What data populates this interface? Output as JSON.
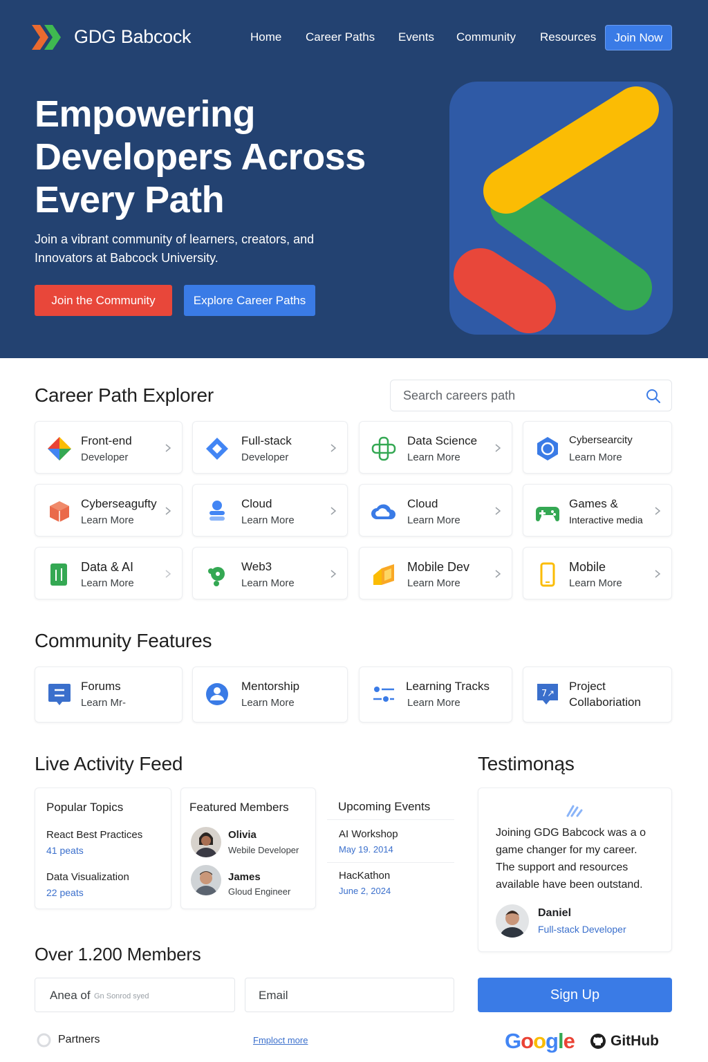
{
  "brand": {
    "name": "GDG Babcock"
  },
  "nav": {
    "items": [
      "Home",
      "Career Paths",
      "Events",
      "Community",
      "Resources"
    ],
    "cta": "Join Now"
  },
  "hero": {
    "title_lines": [
      "Empowering",
      "Developers Across",
      "Every Path"
    ],
    "subtitle_lines": [
      "Join a vibrant community of learners, creators, and",
      "Innovators at Babcock University."
    ],
    "primary_button": "Join the Community",
    "secondary_button": "Explore Career Paths"
  },
  "career_explorer": {
    "title": "Career Path Explorer",
    "search_placeholder": "Search careers path",
    "cards": [
      {
        "title": "Front-end",
        "subtitle": "Developer",
        "icon": "frontend-icon"
      },
      {
        "title": "Full-stack",
        "subtitle": "Developer",
        "icon": "fullstack-icon"
      },
      {
        "title": "Data Science",
        "subtitle": "Learn More",
        "icon": "data-science-icon"
      },
      {
        "title": "Cybersearcity",
        "subtitle": "Learn More",
        "icon": "cybersecurity-icon"
      },
      {
        "title": "Cyberseagufty",
        "subtitle": "Learn More",
        "icon": "cube-icon"
      },
      {
        "title": "Cloud",
        "subtitle": "Learn More",
        "icon": "cloud-stack-icon"
      },
      {
        "title": "Cloud",
        "subtitle": "Learn More",
        "icon": "cloud-icon"
      },
      {
        "title": "Games &",
        "subtitle": "Interactive media",
        "icon": "gamepad-icon"
      },
      {
        "title": "Data & AI",
        "subtitle": "Learn More",
        "icon": "data-ai-icon"
      },
      {
        "title": "Web3",
        "subtitle": "Learn More",
        "icon": "web3-icon"
      },
      {
        "title": "Mobile Dev",
        "subtitle": "Learn More",
        "icon": "mobile-dev-icon"
      },
      {
        "title": "Mobile",
        "subtitle": "Learn More",
        "icon": "mobile-icon"
      }
    ]
  },
  "community_features": {
    "title": "Community Features",
    "cards": [
      {
        "title": "Forums",
        "subtitle": "Learn Mr-",
        "icon": "forum-icon"
      },
      {
        "title": "Mentorship",
        "subtitle": "Learn More",
        "icon": "person-icon"
      },
      {
        "title": "Learning Tracks",
        "subtitle": "Learn More",
        "icon": "tracks-icon"
      },
      {
        "title": "Project",
        "subtitle": "Collaboriation",
        "icon": "collab-icon"
      }
    ]
  },
  "activity_feed": {
    "title": "Live Activity Feed",
    "popular_topics": {
      "heading": "Popular Topics",
      "items": [
        {
          "name": "React Best Practices",
          "count": "41 peats"
        },
        {
          "name": "Data Visualization",
          "count": "22 peats"
        }
      ]
    },
    "featured_members": {
      "heading": "Featured Members",
      "items": [
        {
          "name": "Olivia",
          "role": "Webile Developer"
        },
        {
          "name": "James",
          "role": "Gloud Engineer"
        }
      ]
    },
    "upcoming_events": {
      "heading": "Upcoming Events",
      "items": [
        {
          "name": "AI Workshop",
          "date": "May 19. 2014"
        },
        {
          "name": "HacKathon",
          "date": "June 2, 2024"
        }
      ]
    }
  },
  "testimonials": {
    "title": "Testimonąs",
    "quote_lines": [
      "Joining GDG Babcock was a o",
      "game changer for my career.",
      "The support and resources",
      "available have been outstand."
    ],
    "author": "Daniel",
    "role": "Full-stack Developer"
  },
  "members": {
    "title": "Over 1.200 Members",
    "area_label": "Anea of",
    "area_hint": "Gn Sonrod syed",
    "email_placeholder": "Email",
    "signup_button": "Sign Up"
  },
  "footer": {
    "partners": "Partners",
    "link": "Fmploct more",
    "google": "Google",
    "github": "GitHub"
  },
  "colors": {
    "hero_bg": "#234271",
    "primary_blue": "#3a7be6",
    "accent_red": "#e8473a",
    "google_yellow": "#fbbc04",
    "google_green": "#34a853",
    "google_red": "#ea4335"
  }
}
